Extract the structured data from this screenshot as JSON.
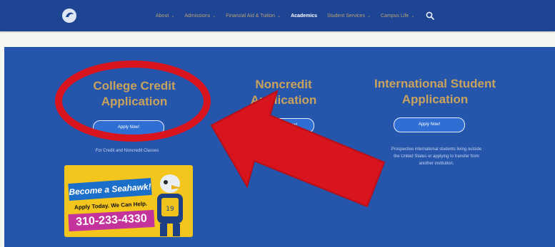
{
  "nav": {
    "items": [
      {
        "label": "About",
        "chevron": true,
        "bold": false
      },
      {
        "label": "Admissions",
        "chevron": true,
        "bold": false
      },
      {
        "label": "Financial Aid & Tuition",
        "chevron": true,
        "bold": false
      },
      {
        "label": "Academics",
        "chevron": false,
        "bold": true
      },
      {
        "label": "Student Services",
        "chevron": true,
        "bold": false
      },
      {
        "label": "Campus Life",
        "chevron": true,
        "bold": false
      }
    ],
    "search_icon": "search-icon",
    "logo_icon": "college-logo"
  },
  "cards": [
    {
      "title_line1": "College Credit",
      "title_line2": "Application",
      "button": "Apply Now!",
      "caption": "For Credit and Noncredit Classes"
    },
    {
      "title_line1": "Noncredit",
      "title_line2": "Application",
      "button": "Apply Now!",
      "caption": ""
    },
    {
      "title_line1": "International Student",
      "title_line2": "Application",
      "button": "Apply Now!",
      "caption_lines": [
        "Prospective international students living outside",
        "the United States or applying to transfer from",
        "another institution."
      ]
    }
  ],
  "promo": {
    "headline": "Become a Seahawk!",
    "subline": "Apply Today. We Can Help.",
    "phone": "310-233-4330"
  },
  "colors": {
    "nav_bg": "#1e4594",
    "hero_bg": "#2556ac",
    "title_gold": "#c9a25c",
    "button_blue": "#2f6fd3",
    "annotation_red": "#d8141f",
    "promo_yellow": "#f3c51d"
  }
}
